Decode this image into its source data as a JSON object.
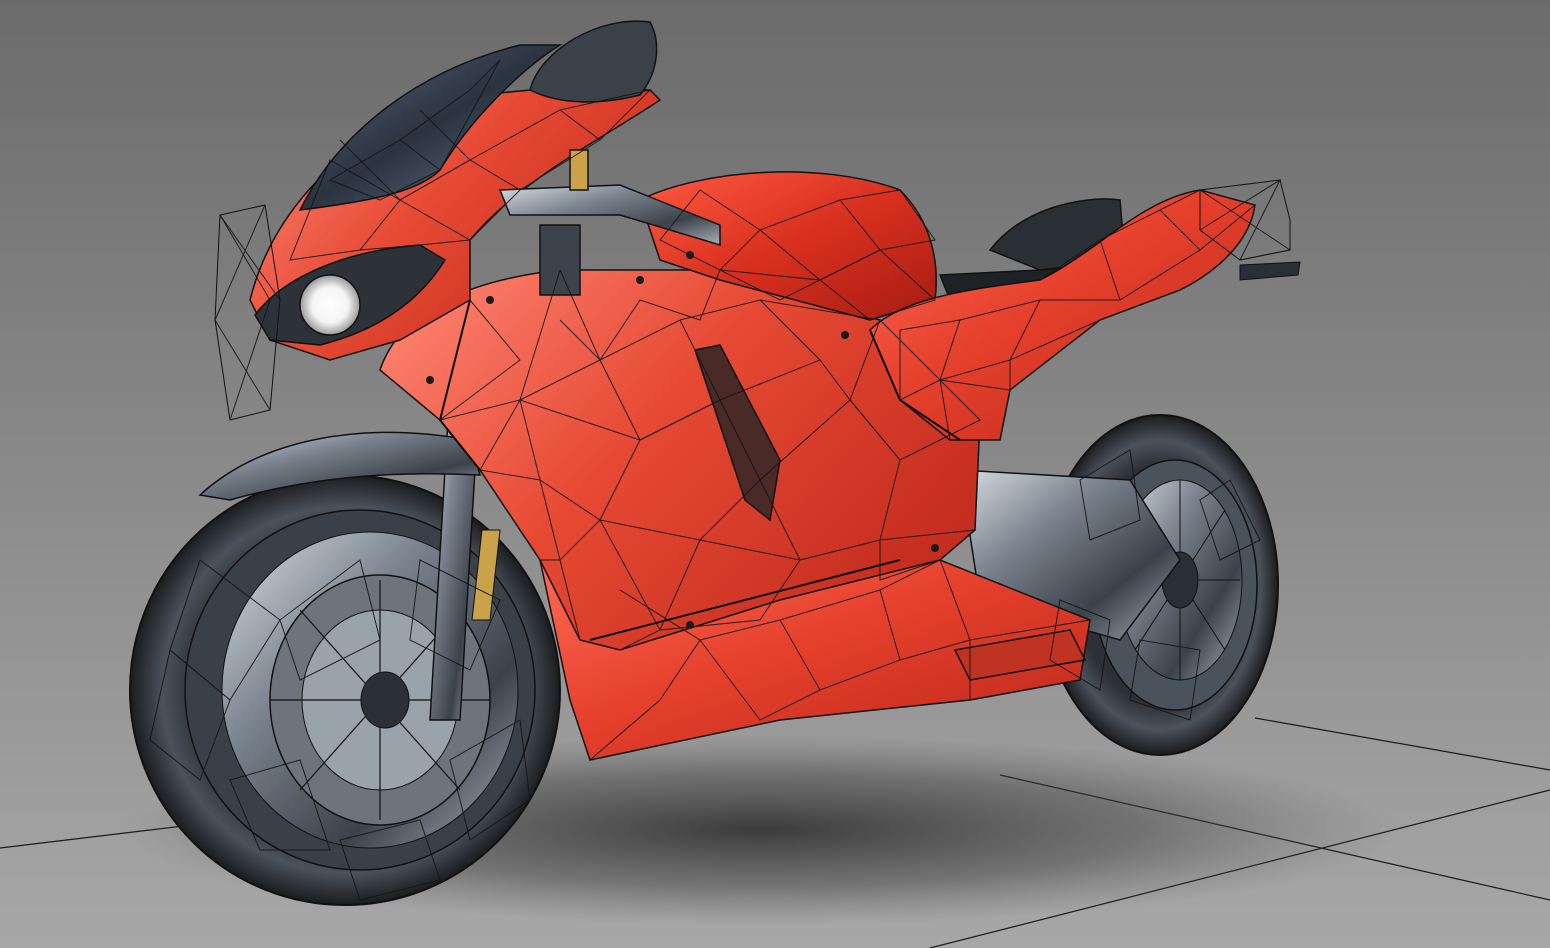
{
  "viewport": {
    "render_mode": "shaded-wireframe",
    "object": "sport-motorcycle",
    "colors": {
      "background_top": "#6e6e6e",
      "background_bottom": "#a9a9a9",
      "floor": "#8f8f8f",
      "body_red": "#e5402c",
      "body_red_dark": "#b8251a",
      "body_red_light": "#ff6a55",
      "chrome": "#5b6470",
      "chrome_light": "#b7c0ca",
      "tire": "#1f2226",
      "wire": "#161616",
      "headlight": "#ffffff",
      "fork_gold": "#c9a24a"
    }
  }
}
